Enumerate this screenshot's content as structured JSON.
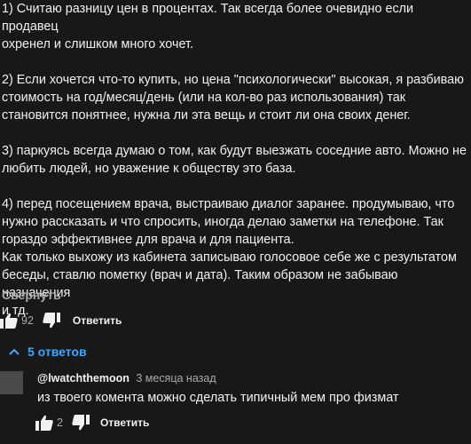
{
  "comment": {
    "paragraphs": [
      "1) Считаю разницу цен в процентах. Так всегда более очевидно если продавец\nохренел и слишком много хочет.",
      "2) Если хочется что-то купить, но цена \"психологически\" высокая, я разбиваю\nстоимость на год/месяц/день (или на кол-во раз использования) так\nстановится понятнее, нужна ли эта вещь и стоит ли она своих денег.",
      "3) паркуясь всегда думаю о том, как будут выезжать соседние авто. Можно не\nлюбить людей, но уважение к обществу это база.",
      "4) перед посещением врача, выстраиваю диалог заранее. продумываю, что\nнужно рассказать и что спросить, иногда делаю заметки на телефоне. Так\nгораздо эффективнее для врача и для пациента.\nКак только выхожу из кабинета записываю голосовое себе же с результатом\nбеседы, ставлю пометку (врач и дата). Таким образом не забываю назначения\nи тд."
    ],
    "collapse_label": "Свернуть",
    "like_count": "92",
    "reply_label": "Ответить"
  },
  "replies_toggle": {
    "label": "5 ответов"
  },
  "reply": {
    "author": "@lwatchthemoon",
    "time": "3 месяца назад",
    "text": "из твоего комента можно сделать типичный мем про физмат",
    "like_count": "2",
    "reply_label": "Ответить"
  },
  "colors": {
    "background": "#181818",
    "text": "#f1f1f1",
    "secondary": "#aaaaaa",
    "accent": "#3ea6ff"
  },
  "icons": [
    "thumbs-up-icon",
    "thumbs-down-icon",
    "chevron-up-icon"
  ]
}
